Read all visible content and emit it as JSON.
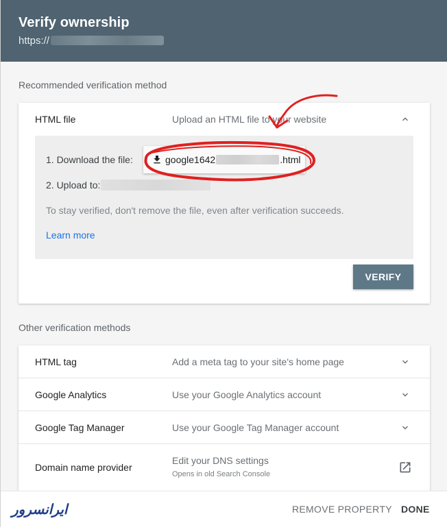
{
  "header": {
    "title": "Verify ownership",
    "url_prefix": "https://"
  },
  "recommended": {
    "section_label": "Recommended verification method",
    "method": {
      "name": "HTML file",
      "description": "Upload an HTML file to your website",
      "expanded": true,
      "steps": {
        "download_label": "1. Download the file:",
        "file_prefix": "google1642",
        "file_suffix": ".html",
        "upload_label": "2. Upload to:"
      },
      "note": "To stay verified, don't remove the file, even after verification succeeds.",
      "learn_more": "Learn more",
      "verify_button": "VERIFY"
    }
  },
  "other": {
    "section_label": "Other verification methods",
    "methods": [
      {
        "name": "HTML tag",
        "description": "Add a meta tag to your site's home page"
      },
      {
        "name": "Google Analytics",
        "description": "Use your Google Analytics account"
      },
      {
        "name": "Google Tag Manager",
        "description": "Use your Google Tag Manager account"
      },
      {
        "name": "Domain name provider",
        "description": "Edit your DNS settings",
        "subtext": "Opens in old Search Console"
      }
    ]
  },
  "footer": {
    "logo_text": "ایرانسرور",
    "remove_property": "REMOVE PROPERTY",
    "done": "DONE"
  },
  "colors": {
    "header_bg": "#4f6370",
    "verify_bg": "#5e7887",
    "link": "#1a73e8",
    "annotation_red": "#e02020",
    "logo": "#1f3f88"
  },
  "icons": [
    "chevron-up-icon",
    "chevron-down-icon",
    "download-icon",
    "open-in-new-icon"
  ]
}
